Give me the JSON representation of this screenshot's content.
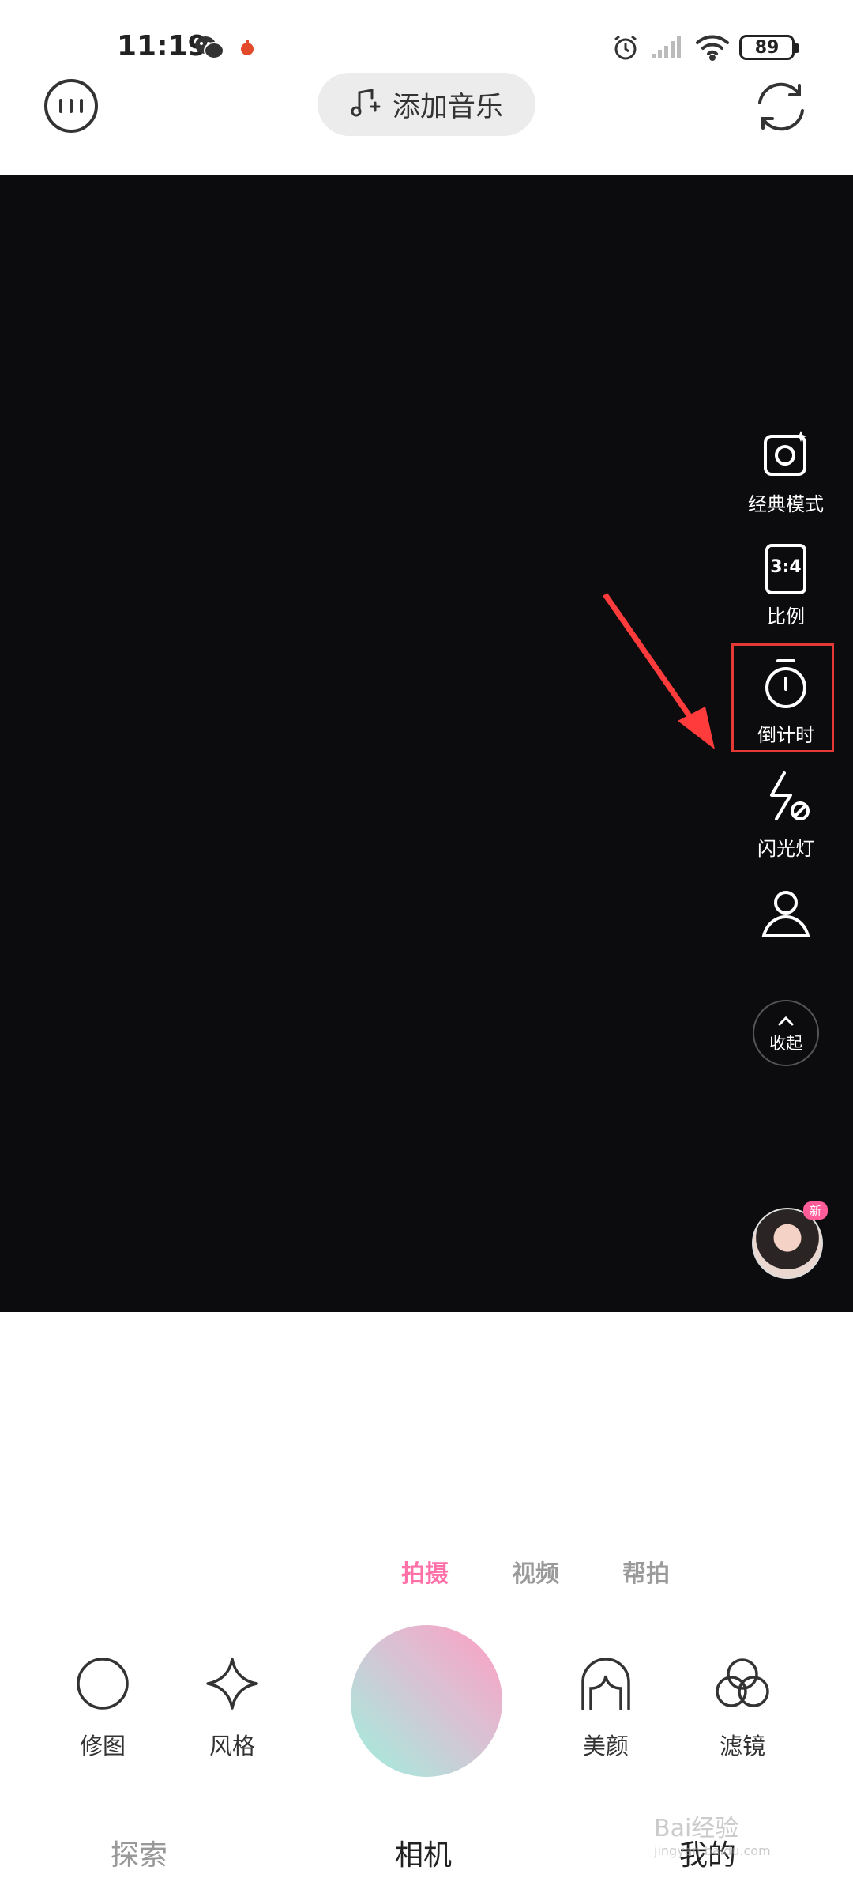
{
  "status_bar": {
    "time": "11:19",
    "battery": "89",
    "icons": [
      "wechat-icon",
      "app-notification-icon",
      "alarm-icon",
      "cellular-signal-icon",
      "wifi-icon",
      "battery-icon"
    ]
  },
  "top_bar": {
    "menu_icon": "menu-dots-icon",
    "add_music_label": "添加音乐",
    "flip_icon": "flip-camera-icon"
  },
  "side_tools": [
    {
      "label": "经典模式",
      "icon": "classic-mode-icon"
    },
    {
      "label": "比例",
      "icon": "ratio-icon",
      "icon_text": "3:4"
    },
    {
      "label": "倒计时",
      "icon": "timer-icon",
      "highlighted": true
    },
    {
      "label": "闪光灯",
      "icon": "flash-off-icon"
    },
    {
      "label": "",
      "icon": "portrait-icon"
    }
  ],
  "collapse_label": "收起",
  "avatar_badge": "新",
  "mode_tabs": [
    {
      "label": "拍摄",
      "active": true
    },
    {
      "label": "视频",
      "active": false
    },
    {
      "label": "帮拍",
      "active": false
    }
  ],
  "bottom_tools": {
    "left": [
      {
        "label": "修图",
        "icon": "edit-photo-icon"
      },
      {
        "label": "风格",
        "icon": "sparkle-icon"
      }
    ],
    "right": [
      {
        "label": "美颜",
        "icon": "beauty-icon"
      },
      {
        "label": "滤镜",
        "icon": "filter-icon"
      }
    ]
  },
  "bottom_nav": [
    "探索",
    "相机",
    "我的"
  ],
  "watermark": {
    "text": "Bai经验",
    "sub": "jingyan.baidu.com"
  },
  "colors": {
    "viewfinder": "#0c0b0d",
    "active_tab": "#ff6fa8",
    "highlight_box": "#e53935",
    "arrow": "#ff3b3b",
    "shutter_start": "#ff9ec2",
    "shutter_end": "#9ff0dd"
  }
}
